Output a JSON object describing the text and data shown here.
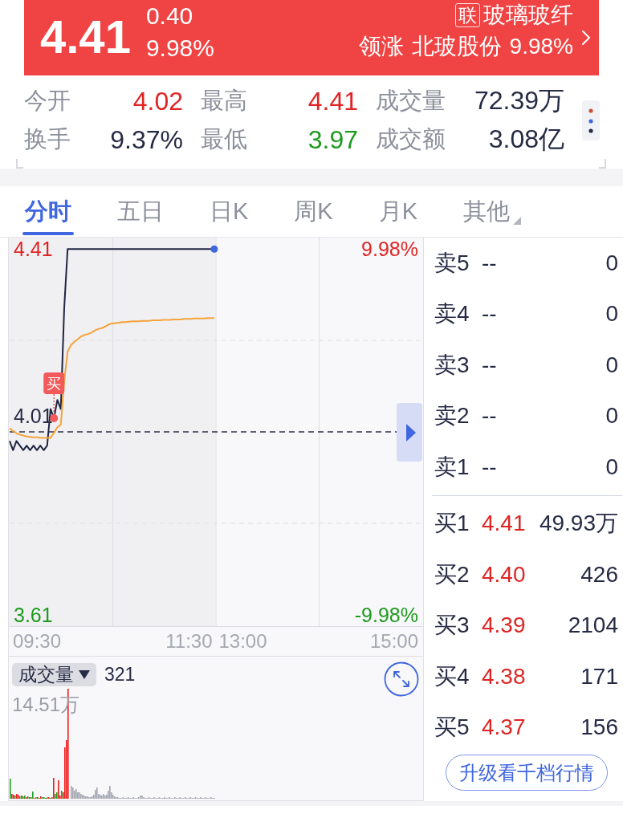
{
  "header": {
    "price": "4.41",
    "change": "0.40",
    "change_pct": "9.98%",
    "tag": "联",
    "sector": "玻璃玻纤",
    "leader_label": "领涨",
    "leader_name": "北玻股份",
    "leader_pct": "9.98%"
  },
  "stats": [
    {
      "label": "今开",
      "value": "4.02",
      "color": "#e02424"
    },
    {
      "label": "最高",
      "value": "4.41",
      "color": "#e02424"
    },
    {
      "label": "成交量",
      "value": "72.39万",
      "color": "#262b45"
    },
    {
      "label": "换手",
      "value": "9.37%",
      "color": "#262b45"
    },
    {
      "label": "最低",
      "value": "3.97",
      "color": "#1e9a1e"
    },
    {
      "label": "成交额",
      "value": "3.08亿",
      "color": "#262b45"
    }
  ],
  "tabs": [
    {
      "label": "分时",
      "kind": "tab",
      "selected": true
    },
    {
      "label": "五日",
      "kind": "tab",
      "selected": false
    },
    {
      "label": "日K",
      "kind": "tab",
      "selected": false
    },
    {
      "label": "周K",
      "kind": "tab",
      "selected": false
    },
    {
      "label": "月K",
      "kind": "tab",
      "selected": false
    },
    {
      "label": "其他",
      "kind": "menu",
      "selected": false
    }
  ],
  "price_chart": {
    "percent_labels": [
      "9.98%",
      "-9.98%"
    ],
    "time_labels": [
      "09:30",
      "11:30",
      "13:00",
      "15:00"
    ],
    "chart_data": {
      "type": "line",
      "categories": [
        null,
        null,
        null,
        null,
        null,
        null,
        null,
        null,
        null,
        null,
        null,
        null,
        null,
        null,
        null,
        null,
        null,
        null,
        null,
        null,
        null,
        null,
        null,
        null,
        null,
        null,
        null,
        null,
        null,
        null,
        null,
        null,
        null,
        null,
        null,
        null,
        null,
        null,
        null,
        null,
        null,
        null,
        null,
        null,
        null,
        null,
        null,
        null,
        null,
        null,
        null,
        null,
        null,
        null,
        null,
        null,
        null,
        null,
        null,
        null,
        null,
        null,
        null,
        null,
        null,
        null,
        null,
        null,
        null,
        null,
        null,
        null,
        null,
        null,
        null,
        null,
        null,
        null,
        null,
        null,
        null,
        null,
        null,
        null,
        null,
        null,
        null,
        null,
        null,
        null,
        null,
        null,
        null,
        null,
        null,
        null,
        null,
        null,
        null,
        null,
        null,
        null,
        null,
        null,
        null,
        null,
        null,
        null,
        null,
        null,
        null,
        null,
        null,
        null,
        null,
        null,
        null,
        null,
        null,
        null,
        null,
        null
      ],
      "series": [
        {
          "color": "#1f2542",
          "values": [
            3.99,
            3.97,
            3.99,
            3.98,
            3.97,
            3.98,
            3.97,
            3.98,
            3.97,
            3.98,
            3.97,
            3.98,
            4.06,
            4.04,
            4.08,
            4.06,
            4.28,
            4.41,
            4.41,
            4.41,
            4.41,
            4.41,
            4.41,
            4.41,
            4.41,
            4.41,
            4.41,
            4.41,
            4.41,
            4.41,
            4.41,
            4.41,
            4.41,
            4.41,
            4.41,
            4.41,
            4.41,
            4.41,
            4.41,
            4.41,
            4.41,
            4.41,
            4.41,
            4.41,
            4.41,
            4.41,
            4.41,
            4.41,
            4.41,
            4.41,
            4.41,
            4.41,
            4.41,
            4.41,
            4.41,
            4.41,
            4.41,
            4.41,
            4.41,
            4.41,
            4.41,
            null,
            null,
            null,
            null,
            null,
            null,
            null,
            null,
            null,
            null,
            null,
            null,
            null,
            null,
            null,
            null,
            null,
            null,
            null,
            null,
            null,
            null,
            null,
            null,
            null,
            null,
            null,
            null,
            null,
            null,
            null,
            null,
            null,
            null,
            null,
            null,
            null,
            null,
            null,
            null,
            null,
            null,
            null,
            null,
            null,
            null,
            null,
            null,
            null,
            null,
            null,
            null,
            null,
            null,
            null,
            null,
            null,
            null,
            null,
            null,
            null
          ]
        },
        {
          "color": "#f5a33a",
          "values": [
            4.018,
            4.012,
            4.007,
            4.004,
            4.002,
            4.0,
            3.999,
            3.998,
            3.998,
            3.997,
            3.997,
            3.997,
            3.997,
            4.008,
            4.02,
            4.026,
            4.12,
            4.186,
            4.2,
            4.207,
            4.213,
            4.219,
            4.222,
            4.224,
            4.227,
            4.232,
            4.235,
            4.237,
            4.24,
            4.245,
            4.247,
            4.248,
            4.249,
            4.25,
            4.25,
            4.251,
            4.252,
            4.252,
            4.252,
            4.253,
            4.253,
            4.253,
            4.254,
            4.254,
            4.254,
            4.255,
            4.255,
            4.255,
            4.256,
            4.256,
            4.256,
            4.257,
            4.257,
            4.257,
            4.258,
            4.258,
            4.258,
            4.258,
            4.259,
            4.259,
            4.259,
            null,
            null,
            null,
            null,
            null,
            null,
            null,
            null,
            null,
            null,
            null,
            null,
            null,
            null,
            null,
            null,
            null,
            null,
            null,
            null,
            null,
            null,
            null,
            null,
            null,
            null,
            null,
            null,
            null,
            null,
            null,
            null,
            null,
            null,
            null,
            null,
            null,
            null,
            null,
            null,
            null,
            null,
            null,
            null,
            null,
            null,
            null,
            null,
            null,
            null,
            null,
            null,
            null,
            null,
            null,
            null,
            null,
            null,
            null,
            null,
            null
          ]
        }
      ],
      "ylim": [
        3.585,
        4.435
      ],
      "yticks": [
        {
          "value": 4.41,
          "label": "4.41"
        },
        {
          "value": 3.61,
          "label": "3.61"
        }
      ],
      "ref_lines": [
        {
          "axis": "y",
          "value": 4.21
        },
        {
          "axis": "y",
          "value": 4.01,
          "label": "4.01"
        },
        {
          "axis": "y",
          "value": 3.81
        }
      ],
      "annotations": [
        "买"
      ]
    }
  },
  "volume_panel": {
    "selector": "成交量",
    "current": "321",
    "max_label": "14.51万"
  },
  "order_book": {
    "asks": [
      {
        "label": "卖5",
        "price": "--",
        "volume": "0",
        "color": "#262b45"
      },
      {
        "label": "卖4",
        "price": "--",
        "volume": "0",
        "color": "#262b45"
      },
      {
        "label": "卖3",
        "price": "--",
        "volume": "0",
        "color": "#262b45"
      },
      {
        "label": "卖2",
        "price": "--",
        "volume": "0",
        "color": "#262b45"
      },
      {
        "label": "卖1",
        "price": "--",
        "volume": "0",
        "color": "#262b45"
      }
    ],
    "bids": [
      {
        "label": "买1",
        "price": "4.41",
        "volume": "49.93万",
        "color": "#e02424"
      },
      {
        "label": "买2",
        "price": "4.40",
        "volume": "426",
        "color": "#e02424"
      },
      {
        "label": "买3",
        "price": "4.39",
        "volume": "2104",
        "color": "#e02424"
      },
      {
        "label": "买4",
        "price": "4.38",
        "volume": "171",
        "color": "#e02424"
      },
      {
        "label": "买5",
        "price": "4.37",
        "volume": "156",
        "color": "#e02424"
      }
    ],
    "upgrade_button": "升级看千档行情"
  }
}
